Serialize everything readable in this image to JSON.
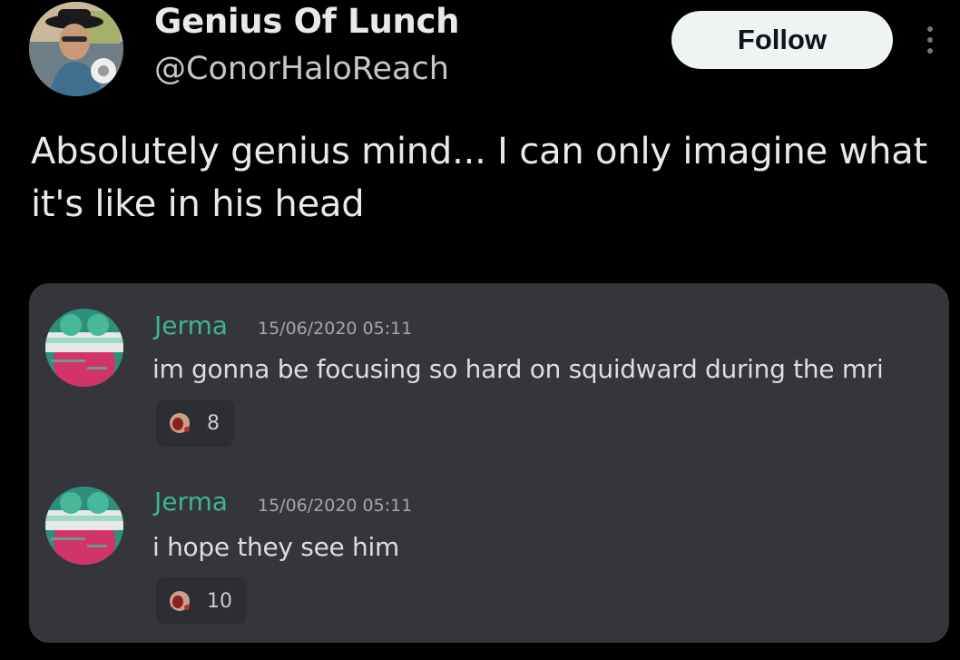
{
  "header": {
    "display_name": "Genius Of Lunch",
    "handle": "@ConorHaloReach",
    "follow_label": "Follow",
    "more_icon": "more-vertical-icon"
  },
  "tweet": {
    "text": "Absolutely genius mind... I can only imagine what it's like in his head"
  },
  "media": {
    "messages": [
      {
        "author": "Jerma",
        "timestamp": "15/06/2020 05:11",
        "text": "im gonna be focusing so hard on squidward during the mri",
        "reaction": {
          "emoji_icon": "bloody-face-emoji-icon",
          "count": "8"
        }
      },
      {
        "author": "Jerma",
        "timestamp": "15/06/2020 05:11",
        "text": "i hope they see him",
        "reaction": {
          "emoji_icon": "bloody-face-emoji-icon",
          "count": "10"
        }
      }
    ]
  },
  "colors": {
    "background": "#000000",
    "card": "#35363b",
    "author_green": "#3fb58c",
    "follow_bg": "#eff3f4"
  }
}
